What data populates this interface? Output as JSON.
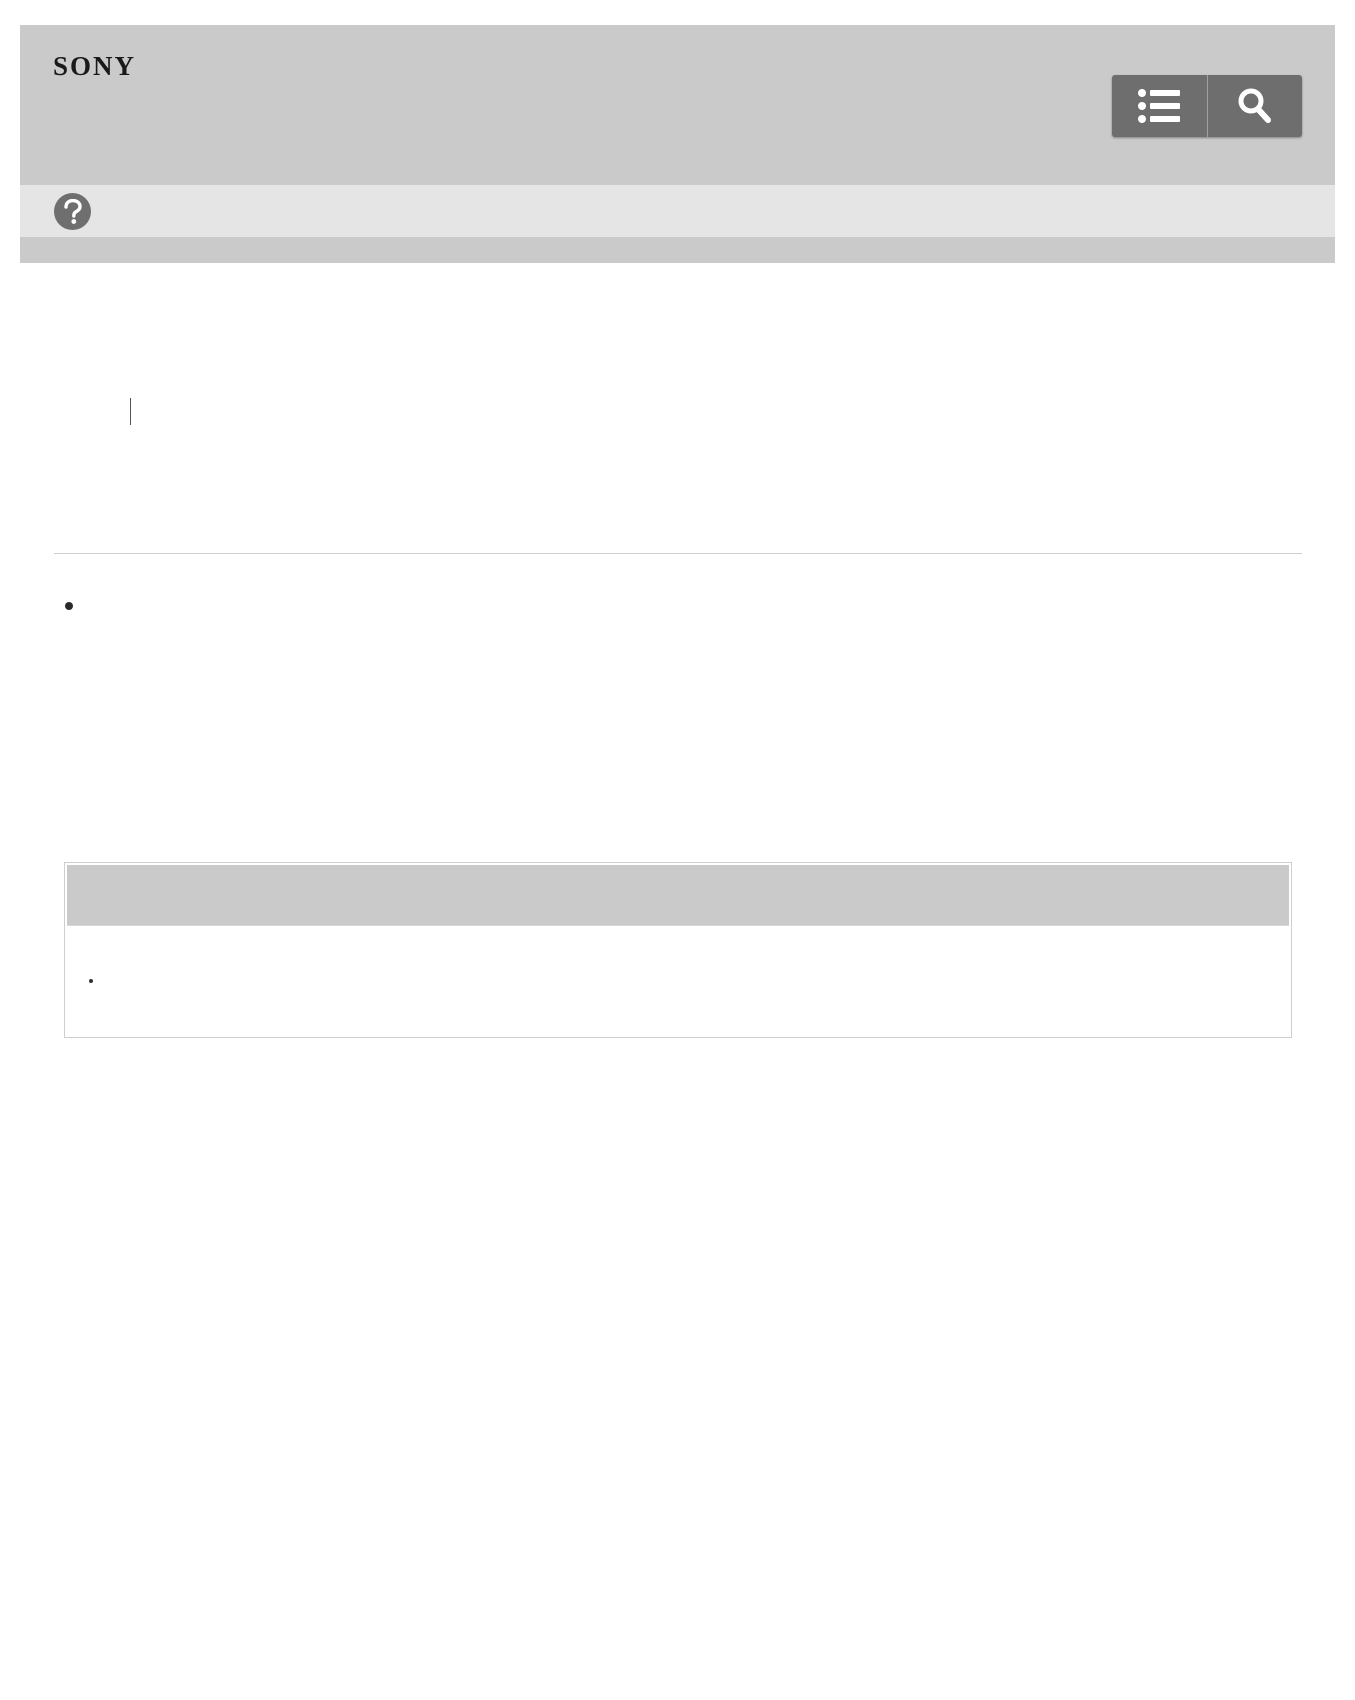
{
  "brand": {
    "logo_text": "SONY"
  },
  "header": {
    "toc_icon": "list-icon",
    "search_icon": "search-icon",
    "help_icon": "help-icon"
  },
  "colors": {
    "header_bg": "#cacaca",
    "help_bar_bg": "#e5e5e5",
    "button_bg": "#6e6e6e",
    "icon_fg": "#ffffff"
  }
}
